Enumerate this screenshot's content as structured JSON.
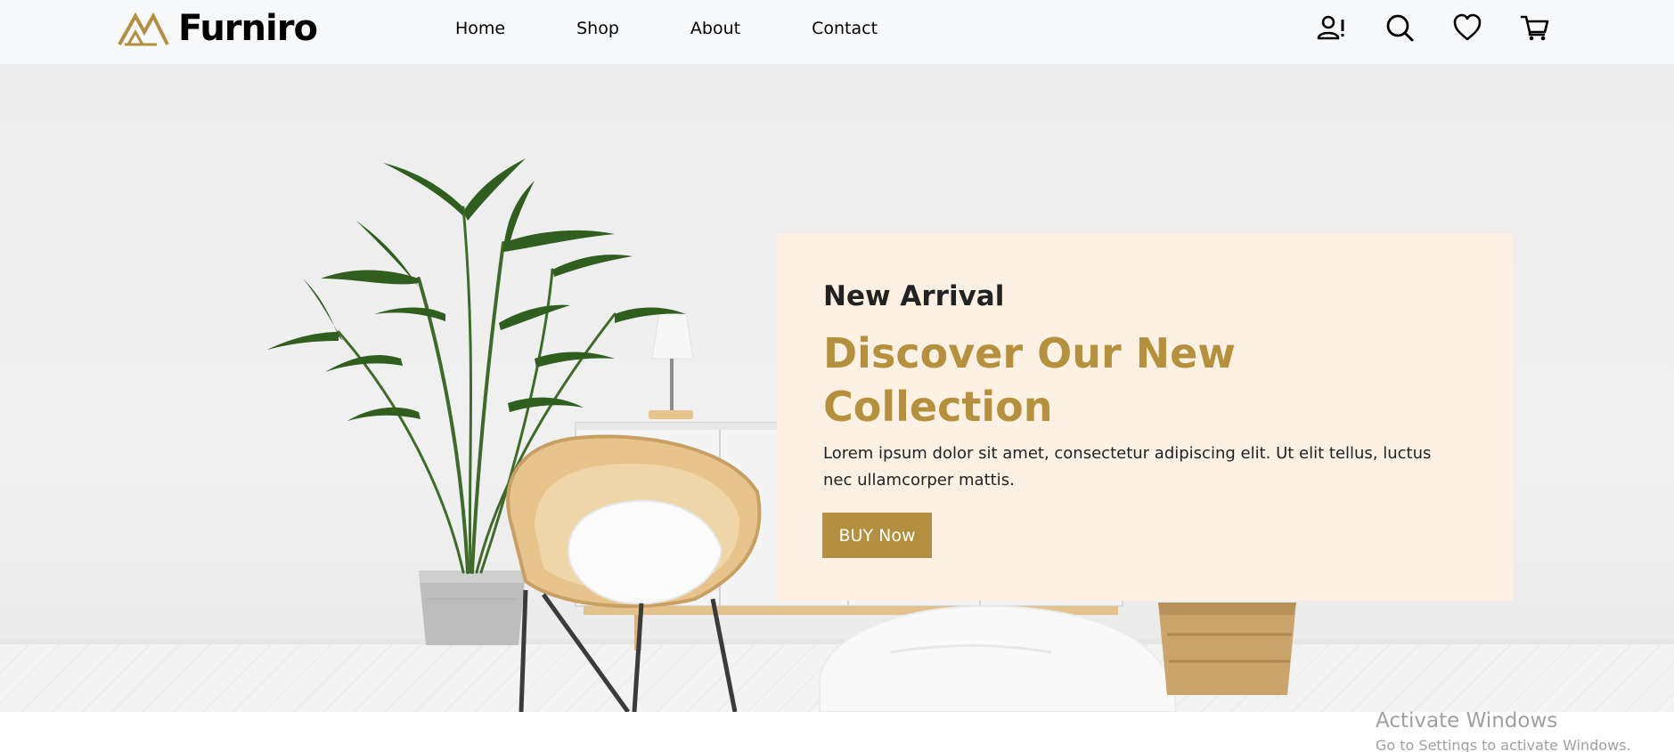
{
  "brand": {
    "name": "Furniro",
    "accent": "#b38f3f"
  },
  "nav": {
    "items": [
      "Home",
      "Shop",
      "About",
      "Contact"
    ]
  },
  "header_icons": [
    "account-alert-icon",
    "search-icon",
    "heart-icon",
    "cart-icon"
  ],
  "hero": {
    "subtitle": "New Arrival",
    "title": "Discover Our New Collection",
    "description": "Lorem ipsum dolor sit amet, consectetur adipiscing elit. Ut elit tellus, luctus nec ullamcorper mattis.",
    "button_label": "BUY Now",
    "card_color": "#fcf1e3",
    "title_color": "#b5903d"
  },
  "watermark": {
    "line1": "Activate Windows",
    "line2": "Go to Settings to activate Windows."
  }
}
